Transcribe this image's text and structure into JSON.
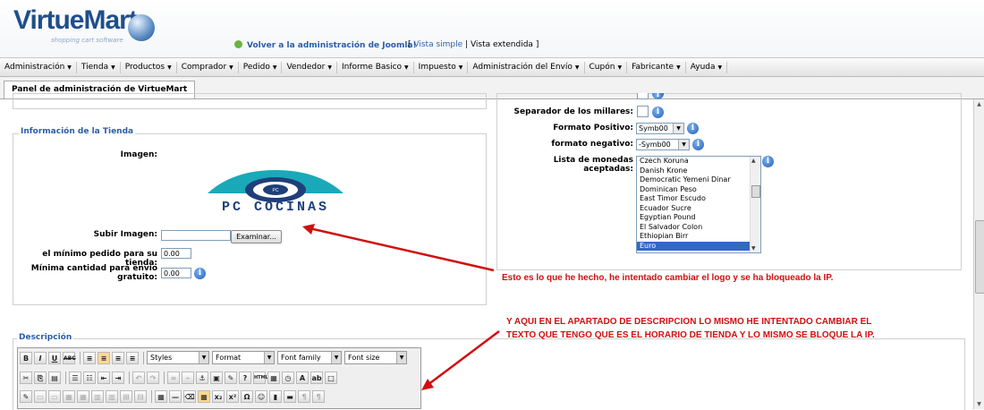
{
  "header": {
    "logo_text": "VirtueMart",
    "logo_tagline": "shopping cart software",
    "back_link": "Volver a la administración de Joomla!",
    "view_open": "[",
    "view_simple": "Vista simple",
    "view_separator": "|",
    "view_extended": "Vista extendida",
    "view_close": "]"
  },
  "menu": [
    {
      "label": "Administración"
    },
    {
      "label": "Tienda"
    },
    {
      "label": "Productos"
    },
    {
      "label": "Comprador"
    },
    {
      "label": "Pedido"
    },
    {
      "label": "Vendedor"
    },
    {
      "label": "Informe Basico"
    },
    {
      "label": "Impuesto"
    },
    {
      "label": "Administración del Envío"
    },
    {
      "label": "Cupón"
    },
    {
      "label": "Fabricante"
    },
    {
      "label": "Ayuda"
    }
  ],
  "tab": {
    "label": "Panel de administración de VirtueMart"
  },
  "store_info": {
    "legend": "Información de la Tienda",
    "image_label": "Imagen:",
    "logo_text": "PC COCINAS",
    "upload_label": "Subir Imagen:",
    "browse_button": "Examinar...",
    "min_order_label": "el mínimo pedido para su tienda:",
    "min_order_value": "0.00",
    "free_shipping_label_1": "Mínima cantidad para envío",
    "free_shipping_label_2": "gratuito:",
    "free_shipping_value": "0.00"
  },
  "currency": {
    "thousands_label": "Separador de los millares:",
    "positive_label": "Formato Positivo:",
    "positive_value": "Symb00",
    "negative_label": "formato negativo:",
    "negative_value": "-Symb00",
    "accepted_label": "Lista de monedas aceptadas:",
    "options": [
      "Czech Koruna",
      "Danish Krone",
      "Democratic Yemeni Dinar",
      "Dominican Peso",
      "East Timor Escudo",
      "Ecuador Sucre",
      "Egyptian Pound",
      "El Salvador Colon",
      "Ethiopian Birr",
      "Euro"
    ],
    "selected": "Euro"
  },
  "description": {
    "legend": "Descripción",
    "styles": "Styles",
    "format": "Format",
    "font_family": "Font family",
    "font_size": "Font size"
  },
  "annotations": {
    "note1": "Esto es lo que he hecho, he intentado cambiar el logo y se ha bloqueado la IP.",
    "note2_line1": "Y AQUI EN EL APARTADO DE DESCRIPCION LO MISMO HE INTENTADO CAMBIAR EL",
    "note2_line2": "TEXTO QUE TENGO QUE ES EL HORARIO DE TIENDA Y LO MISMO SE BLOQUE LA IP."
  },
  "colors": {
    "link": "#2b5ea6",
    "annotation": "#d01010",
    "logo_teal": "#1aa9b8",
    "logo_navy": "#1e3f7a"
  }
}
